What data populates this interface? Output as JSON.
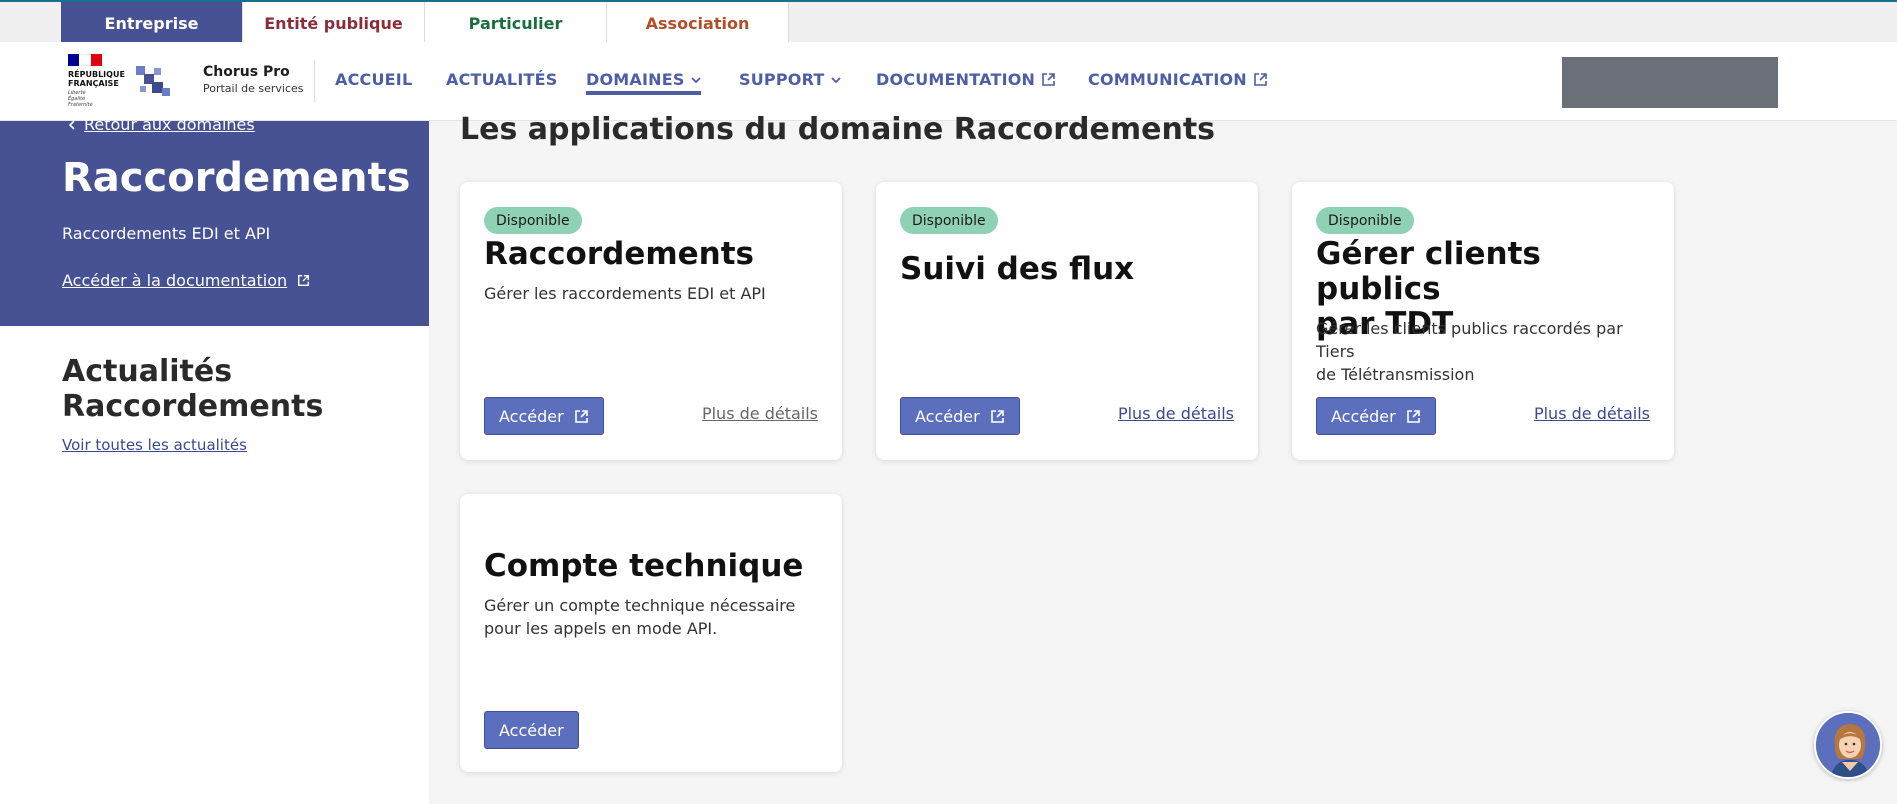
{
  "audience_tabs": [
    {
      "label": "Entreprise",
      "color": "#ffffff",
      "active": true
    },
    {
      "label": "Entité publique",
      "color": "#8b2d3a",
      "active": false
    },
    {
      "label": "Particulier",
      "color": "#1b6e3f",
      "active": false
    },
    {
      "label": "Association",
      "color": "#b44e2a",
      "active": false
    }
  ],
  "header": {
    "republic_text": [
      "RÉPUBLIQUE",
      "FRANÇAISE"
    ],
    "motto": [
      "Liberté",
      "Égalité",
      "Fraternité"
    ],
    "brand_title": "Chorus Pro",
    "brand_subtitle": "Portail de services",
    "nav": [
      {
        "label": "ACCUEIL"
      },
      {
        "label": "ACTUALITÉS"
      },
      {
        "label": "DOMAINES",
        "icon": "chevron-down-icon",
        "active": true
      },
      {
        "label": "SUPPORT",
        "icon": "chevron-down-icon"
      },
      {
        "label": "DOCUMENTATION",
        "icon": "external-link-icon"
      },
      {
        "label": "COMMUNICATION",
        "icon": "external-link-icon"
      }
    ]
  },
  "sidebar": {
    "back_label": "Retour aux domaines",
    "title": "Raccordements",
    "description": "Raccordements EDI et API",
    "doc_link": "Accéder à la documentation",
    "news_title_line1": "Actualités",
    "news_title_line2": "Raccordements",
    "news_link": "Voir toutes les actualités"
  },
  "main": {
    "title": "Les applications du domaine Raccordements",
    "cards": [
      {
        "badge": "Disponible",
        "title": "Raccordements",
        "description": "Gérer les raccordements EDI et API",
        "button": "Accéder",
        "details": "Plus de détails"
      },
      {
        "badge": "Disponible",
        "title": "Suivi des flux",
        "description": "",
        "button": "Accéder",
        "details": "Plus de détails"
      },
      {
        "badge": "Disponible",
        "title_line1": "Gérer clients publics",
        "title_line2": "par TDT",
        "description_line1": "Gérer les clients publics raccordés par Tiers",
        "description_line2": "de Télétransmission",
        "button": "Accéder",
        "details": "Plus de détails"
      },
      {
        "title": "Compte technique",
        "description_line1": "Gérer un compte technique nécessaire",
        "description_line2": "pour les appels en mode API.",
        "button": "Accéder"
      }
    ]
  },
  "colors": {
    "primary": "#465294",
    "button": "#5b6fbd",
    "badge": "#8fd1b5",
    "link": "#3a4a8c"
  }
}
